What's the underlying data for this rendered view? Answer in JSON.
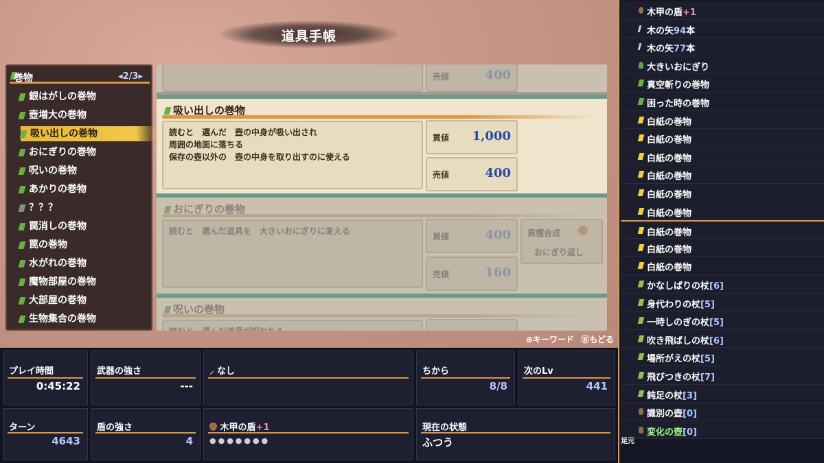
{
  "title": "道具手帳",
  "category": {
    "label": "巻物",
    "page": "2/3",
    "items": [
      "銀はがしの巻物",
      "壺増大の巻物",
      "吸い出しの巻物",
      "おにぎりの巻物",
      "呪いの巻物",
      "あかりの巻物",
      "？？？",
      "罠消しの巻物",
      "罠の巻物",
      "水がれの巻物",
      "魔物部屋の巻物",
      "大部屋の巻物",
      "生物集合の巻物"
    ],
    "selected_index": 2
  },
  "cards": {
    "top_sell_label": "売値",
    "top_sell_value": "400",
    "main": {
      "title": "吸い出しの巻物",
      "desc_line1": "読むと　選んだ　壺の中身が吸い出され",
      "desc_line2": "周囲の地面に落ちる",
      "desc_line3": "保存の壺以外の　壺の中身を取り出すのに使える",
      "buy_label": "買値",
      "buy_value": "1,000",
      "sell_label": "売値",
      "sell_value": "400"
    },
    "second": {
      "title": "おにぎりの巻物",
      "desc_line1": "読むと　選んだ道具を　大きいおにぎりに変える",
      "buy_label": "買値",
      "buy_value": "400",
      "sell_label": "売値",
      "sell_value": "160",
      "trait_label": "異種合成",
      "trait_value": "おにぎり返し"
    },
    "third": {
      "title": "呪いの巻物",
      "desc_line1": "読むと　選んだ道具が呪われる"
    }
  },
  "hint": {
    "keyword": "キーワード",
    "back": "もどる"
  },
  "status": {
    "play_time_label": "プレイ時間",
    "play_time": "0:45:22",
    "weapon_label": "武器の強さ",
    "weapon": "---",
    "weapon_name": "なし",
    "power_label": "ちから",
    "power": "8/8",
    "next_lv_label": "次のLv",
    "next_lv": "441",
    "turn_label": "ターン",
    "turn": "4643",
    "shield_label": "盾の強さ",
    "shield": "4",
    "shield_name": "木甲の盾",
    "shield_plus": "+1",
    "state_label": "現在の状態",
    "state": "ふつう"
  },
  "inventory": [
    {
      "name": "木甲の盾",
      "extra": "+1",
      "extra_class": "plus"
    },
    {
      "name": "木の矢",
      "extra": "94",
      "suffix": "本",
      "extra_class": "num"
    },
    {
      "name": "木の矢",
      "extra": "77",
      "suffix": "本",
      "extra_class": "num"
    },
    {
      "name": "大きいおにぎり"
    },
    {
      "name": "真空斬りの巻物"
    },
    {
      "name": "困った時の巻物"
    },
    {
      "name": "白紙の巻物"
    },
    {
      "name": "白紙の巻物"
    },
    {
      "name": "白紙の巻物"
    },
    {
      "name": "白紙の巻物"
    },
    {
      "name": "白紙の巻物"
    },
    {
      "name": "白紙の巻物"
    },
    {
      "name": "白紙の巻物"
    },
    {
      "name": "白紙の巻物"
    },
    {
      "name": "白紙の巻物"
    },
    {
      "name": "かなしばりの杖",
      "extra": "[6]",
      "extra_class": "num"
    },
    {
      "name": "身代わりの杖",
      "extra": "[5]",
      "extra_class": "num"
    },
    {
      "name": "一時しのぎの杖",
      "extra": "[5]",
      "extra_class": "num"
    },
    {
      "name": "吹き飛ばしの杖",
      "extra": "[6]",
      "extra_class": "num"
    },
    {
      "name": "場所がえの杖",
      "extra": "[5]",
      "extra_class": "num"
    },
    {
      "name": "飛びつきの杖",
      "extra": "[7]",
      "extra_class": "num"
    },
    {
      "name": "鈍足の杖",
      "extra": "[3]",
      "extra_class": "num"
    },
    {
      "name": "識別の壺",
      "extra": "[0]",
      "extra_class": "num"
    },
    {
      "name": "変化の壺",
      "extra": "[0]",
      "extra_class": "num",
      "green": true
    }
  ],
  "foot_label": "足元"
}
